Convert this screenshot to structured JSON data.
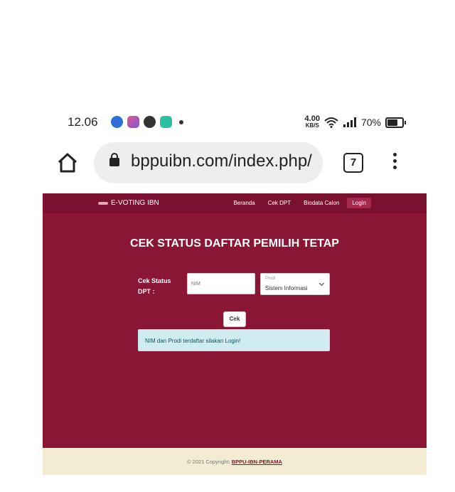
{
  "status_bar": {
    "time": "12.06",
    "net_speed_value": "4.00",
    "net_speed_unit": "KB/S",
    "battery_percent": "70%",
    "notification_icons": [
      "chrome-icon",
      "app-icon",
      "game-icon",
      "chat-icon"
    ]
  },
  "browser": {
    "url": "bppuibn.com/index.php/",
    "tab_count": "7"
  },
  "site": {
    "brand": "E-VOTING IBN",
    "nav": [
      {
        "label": "Beranda"
      },
      {
        "label": "Cek DPT"
      },
      {
        "label": "Biodata Calon"
      },
      {
        "label": "Login"
      }
    ],
    "active_nav": "Login",
    "title": "CEK STATUS DAFTAR PEMILIH TETAP",
    "form": {
      "label": "Cek Status DPT :",
      "nim_placeholder": "NIM",
      "nim_value": "",
      "prodi_label": "Prodi",
      "prodi_selected": "Sistem Informasi",
      "submit_label": "Cek"
    },
    "alert": "NIM dan Prodi terdaftar silakan Login!",
    "footer": {
      "text": "© 2021 Copyright:",
      "link": "BPPU-IBN-PERAMA"
    },
    "colors": {
      "primary": "#8b1535",
      "navbar": "#7a1130",
      "footer_bg": "#f3ecd3",
      "alert_bg": "#d1ecf1"
    }
  }
}
